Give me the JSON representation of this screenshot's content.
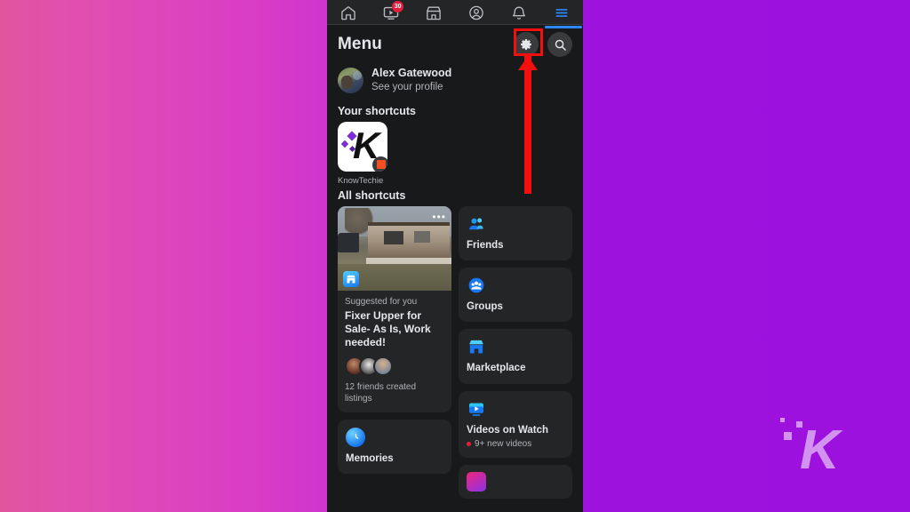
{
  "background": {
    "gradient_left": "#e1559f",
    "gradient_right": "#9d11de",
    "watermark_letter": "K",
    "watermark_name": "knowtechie-watermark"
  },
  "topbar": {
    "items": [
      {
        "name": "home-icon",
        "label": "Home",
        "badge": null
      },
      {
        "name": "watch-icon",
        "label": "Watch",
        "badge": "30"
      },
      {
        "name": "marketplace-icon",
        "label": "Marketplace",
        "badge": null
      },
      {
        "name": "profile-icon",
        "label": "Profile",
        "badge": null
      },
      {
        "name": "notifications-bell-icon",
        "label": "Notifications",
        "badge": null
      },
      {
        "name": "menu-hamburger-icon",
        "label": "Menu",
        "badge": null
      }
    ],
    "active_index": 5,
    "active_color": "#2d88ff"
  },
  "header": {
    "title": "Menu",
    "settings_label": "Settings",
    "search_label": "Search"
  },
  "profile": {
    "name": "Alex Gatewood",
    "subtitle": "See your profile"
  },
  "your_shortcuts": {
    "section_title": "Your shortcuts",
    "items": [
      {
        "label": "KnowTechie",
        "logo_letter": "K"
      }
    ]
  },
  "all_shortcuts": {
    "section_title": "All shortcuts",
    "marketplace_card": {
      "eyebrow": "Suggested for you",
      "title": "Fixer Upper for Sale- As Is, Work needed!",
      "footnote": "12 friends created listings",
      "overflow_glyph": "•••"
    },
    "memories_tile": {
      "label": "Memories",
      "icon": "clock-icon"
    },
    "tiles": [
      {
        "label": "Friends",
        "icon": "friends-icon",
        "sub": null
      },
      {
        "label": "Groups",
        "icon": "groups-icon",
        "sub": null
      },
      {
        "label": "Marketplace",
        "icon": "marketplace-store-icon",
        "sub": null
      },
      {
        "label": "Videos on Watch",
        "icon": "video-play-icon",
        "sub": "9+ new videos"
      }
    ]
  },
  "annotation": {
    "highlight_color": "#f40f0f",
    "highlight_target": "settings-gear-button"
  }
}
